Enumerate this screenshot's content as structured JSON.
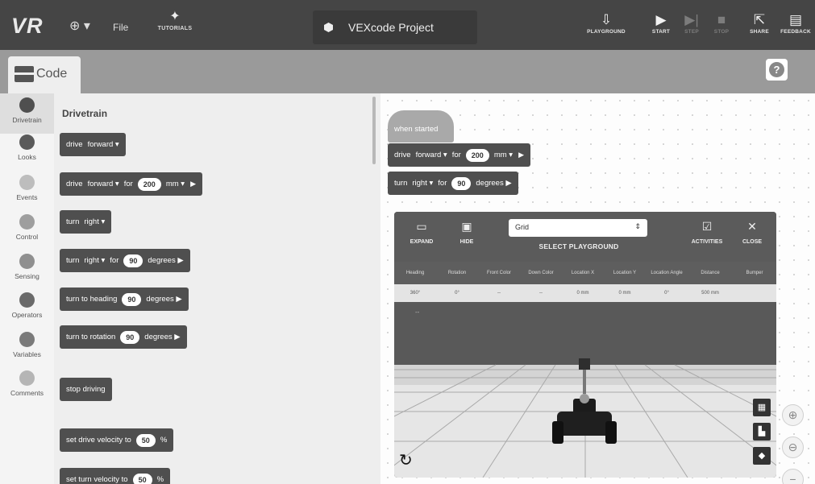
{
  "topbar": {
    "logo": "VR",
    "globe_caret": "⊕ ▾",
    "file": "File",
    "tutorials": "TUTORIALS",
    "project_name": "VEXcode Project",
    "buttons": [
      {
        "label": "PLAYGROUND",
        "icon": "download-icon",
        "glyph": "⇩",
        "dim": false
      },
      {
        "label": "START",
        "icon": "play-icon",
        "glyph": "▶",
        "dim": false
      },
      {
        "label": "STEP",
        "icon": "step-icon",
        "glyph": "▶|",
        "dim": true
      },
      {
        "label": "STOP",
        "icon": "stop-icon",
        "glyph": "■",
        "dim": true
      },
      {
        "label": "SHARE",
        "icon": "share-icon",
        "glyph": "⇱",
        "dim": false
      },
      {
        "label": "FEEDBACK",
        "icon": "feedback-icon",
        "glyph": "▤",
        "dim": false
      }
    ]
  },
  "subbar": {
    "code_tab": "Code",
    "help": "?"
  },
  "categories": [
    {
      "label": "Drivetrain",
      "color": "#4f4f4f"
    },
    {
      "label": "Looks",
      "color": "#5a5a5a"
    },
    {
      "label": "Events",
      "color": "#bdbdbd"
    },
    {
      "label": "Control",
      "color": "#9e9e9e"
    },
    {
      "label": "Sensing",
      "color": "#8f8f8f"
    },
    {
      "label": "Operators",
      "color": "#6a6a6a"
    },
    {
      "label": "Variables",
      "color": "#7a7a7a"
    },
    {
      "label": "Comments",
      "color": "#b5b5b5"
    }
  ],
  "palette": {
    "title": "Drivetrain",
    "blocks": {
      "b1": {
        "w1": "drive",
        "w2": "forward ▾"
      },
      "b2": {
        "w1": "drive",
        "w2": "forward ▾",
        "w3": "for",
        "v": "200",
        "w4": "mm ▾",
        "tri": "▶"
      },
      "b3": {
        "w1": "turn",
        "w2": "right ▾"
      },
      "b4": {
        "w1": "turn",
        "w2": "right ▾",
        "w3": "for",
        "v": "90",
        "w4": "degrees ▶"
      },
      "b5": {
        "w1": "turn to heading",
        "v": "90",
        "w4": "degrees ▶"
      },
      "b6": {
        "w1": "turn to rotation",
        "v": "90",
        "w4": "degrees ▶"
      },
      "b7": {
        "w1": "stop driving"
      },
      "b8": {
        "w1": "set drive velocity to",
        "v": "50",
        "w4": "%"
      },
      "b9": {
        "w1": "set turn velocity to",
        "v": "50",
        "w4": "%"
      }
    }
  },
  "workspace": {
    "hat": "when started",
    "s1": {
      "w1": "drive",
      "w2": "forward ▾",
      "w3": "for",
      "v": "200",
      "w4": "mm ▾",
      "tri": "▶"
    },
    "s2": {
      "w1": "turn",
      "w2": "right ▾",
      "w3": "for",
      "v": "90",
      "w4": "degrees ▶"
    }
  },
  "playground": {
    "expand": "EXPAND",
    "hide": "HIDE",
    "select_value": "Grid",
    "select_caret": "⇕",
    "select_title": "SELECT PLAYGROUND",
    "activities": "ACTIVITIES",
    "close": "CLOSE",
    "close_glyph": "✕",
    "headers": [
      "Heading",
      "Rotation",
      "Front Color",
      "Down Color",
      "Location X",
      "Location Y",
      "Location Angle",
      "Distance",
      "Bumper"
    ],
    "values": [
      "360°",
      "0°",
      "--",
      "--",
      "0 mm",
      "0 mm",
      "0°",
      "500 mm",
      ""
    ],
    "dash": "--",
    "reset_glyph": "↻"
  },
  "zoom": {
    "in": "⊕",
    "out": "⊖",
    "minus": "−"
  }
}
